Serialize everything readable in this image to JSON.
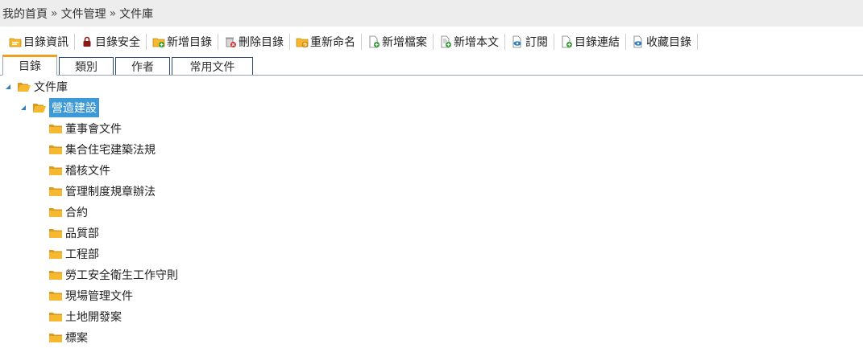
{
  "breadcrumb": {
    "items": [
      "我的首頁",
      "文件管理",
      "文件庫"
    ],
    "separator": "»"
  },
  "toolbar": {
    "buttons": [
      {
        "label": "目錄資訊",
        "icon": "folder-info-icon"
      },
      {
        "label": "目錄安全",
        "icon": "lock-icon"
      },
      {
        "label": "新增目錄",
        "icon": "folder-add-icon"
      },
      {
        "label": "刪除目錄",
        "icon": "trash-delete-icon"
      },
      {
        "label": "重新命名",
        "icon": "folder-rename-icon"
      },
      {
        "label": "新增檔案",
        "icon": "file-add-icon"
      },
      {
        "label": "新增本文",
        "icon": "document-add-icon"
      },
      {
        "label": "訂閱",
        "icon": "subscribe-eye-icon"
      },
      {
        "label": "目錄連結",
        "icon": "link-add-icon"
      },
      {
        "label": "收藏目錄",
        "icon": "favorite-eye-icon"
      }
    ]
  },
  "tabs": [
    {
      "label": "目錄",
      "active": true
    },
    {
      "label": "類別",
      "active": false
    },
    {
      "label": "作者",
      "active": false
    },
    {
      "label": "常用文件",
      "active": false
    }
  ],
  "tree": {
    "root": "文件庫",
    "selected": "營造建設",
    "children": [
      "董事會文件",
      "集合住宅建築法規",
      "稽核文件",
      "管理制度規章辦法",
      "合約",
      "品質部",
      "工程部",
      "勞工安全衛生工作守則",
      "現場管理文件",
      "土地開發案",
      "標案"
    ]
  },
  "colors": {
    "folder": "#f5b82e",
    "selected_bg": "#3d9ad6",
    "tab_active_top": "#f0a020",
    "tab_border": "#2b4a7a"
  }
}
